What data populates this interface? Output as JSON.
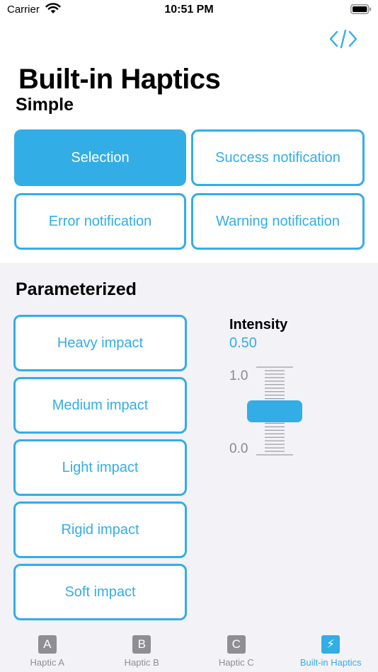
{
  "status_bar": {
    "carrier": "Carrier",
    "time": "10:51 PM"
  },
  "header": {
    "title": "Built-in Haptics",
    "code_icon": "code-brackets-icon"
  },
  "simple": {
    "title": "Simple",
    "buttons": [
      {
        "label": "Selection",
        "selected": true
      },
      {
        "label": "Success notification",
        "selected": false
      },
      {
        "label": "Error notification",
        "selected": false
      },
      {
        "label": "Warning notification",
        "selected": false
      }
    ]
  },
  "parameterized": {
    "title": "Parameterized",
    "buttons": [
      {
        "label": "Heavy impact"
      },
      {
        "label": "Medium impact"
      },
      {
        "label": "Light impact"
      },
      {
        "label": "Rigid impact"
      },
      {
        "label": "Soft impact"
      }
    ],
    "intensity": {
      "label": "Intensity",
      "value": "0.50",
      "max_label": "1.0",
      "min_label": "0.0",
      "level": 0.5
    }
  },
  "tab_bar": {
    "tabs": [
      {
        "icon_letter": "A",
        "label": "Haptic A",
        "active": false
      },
      {
        "icon_letter": "B",
        "label": "Haptic B",
        "active": false
      },
      {
        "icon_letter": "C",
        "label": "Haptic C",
        "active": false
      },
      {
        "icon_letter": "⚡",
        "label": "Built-in Haptics",
        "active": true
      }
    ]
  },
  "colors": {
    "accent": "#33ade6",
    "background_secondary": "#f2f2f7",
    "inactive": "#8e8e93"
  }
}
